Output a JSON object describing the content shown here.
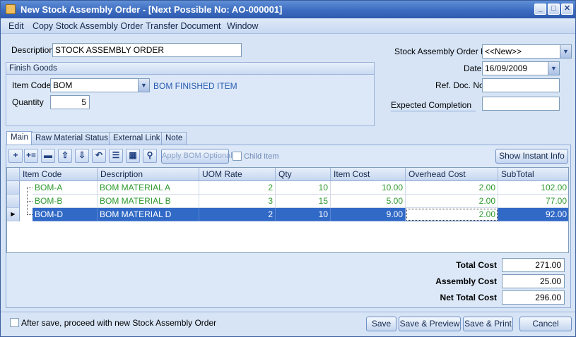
{
  "window": {
    "title": "New Stock Assembly Order  - [Next Possible No: AO-000001]"
  },
  "menu": [
    "Edit",
    "Copy Stock Assembly Order",
    "Transfer Document",
    "Window"
  ],
  "form": {
    "description_label": "Description",
    "description_value": "STOCK ASSEMBLY ORDER",
    "finish_goods_title": "Finish Goods",
    "item_code_label": "Item Code",
    "item_code_value": "BOM",
    "item_desc": "BOM FINISHED ITEM",
    "quantity_label": "Quantity",
    "quantity_value": "5",
    "order_no_label": "Stock Assembly Order N",
    "order_no_value": "<<New>>",
    "date_label": "Date",
    "date_value": "16/09/2009",
    "ref_label": "Ref. Doc. No",
    "ref_value": "",
    "expected_label": "Expected Completion",
    "expected_value": ""
  },
  "tabs": [
    "Main",
    "Raw Material Status",
    "External Link",
    "Note"
  ],
  "toolbar": {
    "apply_bom": "Apply BOM Optional",
    "child_item": "Child Item",
    "show_instant_info": "Show Instant Info"
  },
  "grid": {
    "columns": [
      "Item Code",
      "Description",
      "UOM Rate",
      "Qty",
      "Item Cost",
      "Overhead Cost",
      "SubTotal"
    ],
    "rows": [
      {
        "code": "BOM-A",
        "desc": "BOM MATERIAL A",
        "uom": "2",
        "qty": "10",
        "cost": "10.00",
        "overhead": "2.00",
        "subtotal": "102.00"
      },
      {
        "code": "BOM-B",
        "desc": "BOM MATERIAL B",
        "uom": "3",
        "qty": "15",
        "cost": "5.00",
        "overhead": "2.00",
        "subtotal": "77.00"
      },
      {
        "code": "BOM-D",
        "desc": "BOM MATERIAL D",
        "uom": "2",
        "qty": "10",
        "cost": "9.00",
        "overhead": "2.00",
        "subtotal": "92.00"
      }
    ]
  },
  "totals": {
    "total_cost_label": "Total Cost",
    "total_cost": "271.00",
    "assembly_cost_label": "Assembly Cost",
    "assembly_cost": "25.00",
    "net_total_label": "Net Total Cost",
    "net_total": "296.00"
  },
  "footer": {
    "after_save": "After save, proceed with new Stock Assembly Order",
    "save": "Save",
    "save_preview": "Save & Preview",
    "save_print": "Save & Print",
    "cancel": "Cancel"
  }
}
